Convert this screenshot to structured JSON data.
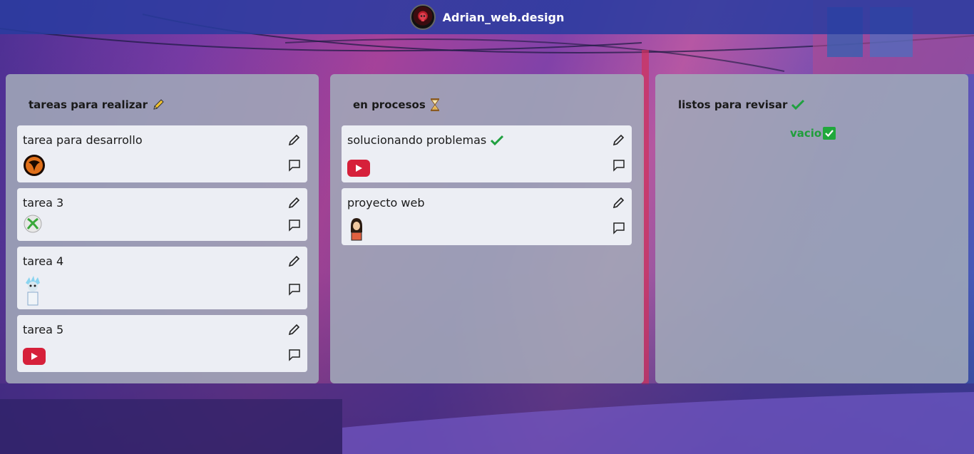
{
  "header": {
    "brand": "Adrian_web.design",
    "avatar_icon": "mortal-kombat-skull-icon"
  },
  "columns": [
    {
      "title": "tareas para realizar",
      "title_icon": "pencil-icon",
      "cards": [
        {
          "title": "tarea para desarrollo",
          "thumb_icon": "mortal-kombat-logo-icon"
        },
        {
          "title": "tarea 3",
          "thumb_icon": "xbox-logo-icon"
        },
        {
          "title": "tarea 4",
          "thumb_icon": "rick-avatar-icon"
        },
        {
          "title": "tarea 5",
          "thumb_icon": "youtube-logo-icon"
        }
      ]
    },
    {
      "title": "en procesos",
      "title_icon": "hourglass-icon",
      "cards": [
        {
          "title": "solucionando problemas",
          "title_icon": "checkmark-icon",
          "thumb_icon": "youtube-logo-icon"
        },
        {
          "title": "proyecto web",
          "thumb_icon": "woman-avatar-icon"
        }
      ]
    },
    {
      "title": "listos para revisar",
      "title_icon": "checkmark-icon",
      "cards": [],
      "empty_text": "vacio"
    }
  ],
  "colors": {
    "topbar": "#283ca0",
    "column_bg": "#a0a8b8",
    "card_bg": "#f0f2f8",
    "empty_text": "#1f9e3a",
    "youtube_red": "#d6203a"
  }
}
